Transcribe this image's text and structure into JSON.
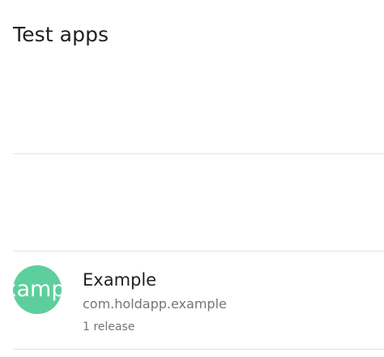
{
  "header": {
    "title": "Test apps"
  },
  "apps": [
    {
      "icon_text": "Example",
      "name": "Example",
      "package": "com.holdapp.example",
      "releases": "1 release"
    }
  ],
  "colors": {
    "app_icon_background": "#5dcf9c",
    "divider": "#e3e3e3",
    "primary_text": "#202124",
    "secondary_text": "#757575"
  }
}
